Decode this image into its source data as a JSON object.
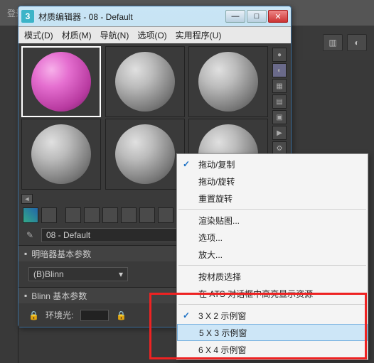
{
  "bg_menu_text": "登录",
  "window": {
    "app_icon_text": "3",
    "title": "材质编辑器 - 08 - Default",
    "buttons": {
      "min": "—",
      "max": "□",
      "close": "✕"
    }
  },
  "menubar": {
    "mode": "模式(D)",
    "material": "材质(M)",
    "navigate": "导航(N)",
    "options": "选项(O)",
    "utility": "实用程序(U)"
  },
  "name_field": "08 - Default",
  "rollups": {
    "shader_header": "明暗器基本参数",
    "shader_value": "(B)Blinn",
    "blinn_header": "Blinn 基本参数",
    "ambient_label": "环境光:"
  },
  "context_menu": {
    "drag_copy": "拖动/复制",
    "drag_rotate": "拖动/旋转",
    "reset_rotate": "重置旋转",
    "render_map": "渲染贴图...",
    "options": "选项...",
    "zoom": "放大...",
    "by_material": "按材质选择",
    "ats_highlight": "在 ATS 对话框中高亮显示资源",
    "grid_3x2": "3 X 2 示例窗",
    "grid_5x3": "5 X 3 示例窗",
    "grid_6x4": "6 X 4 示例窗"
  },
  "dropdown_caret": "▾",
  "bullet": "▪",
  "check": "✓"
}
